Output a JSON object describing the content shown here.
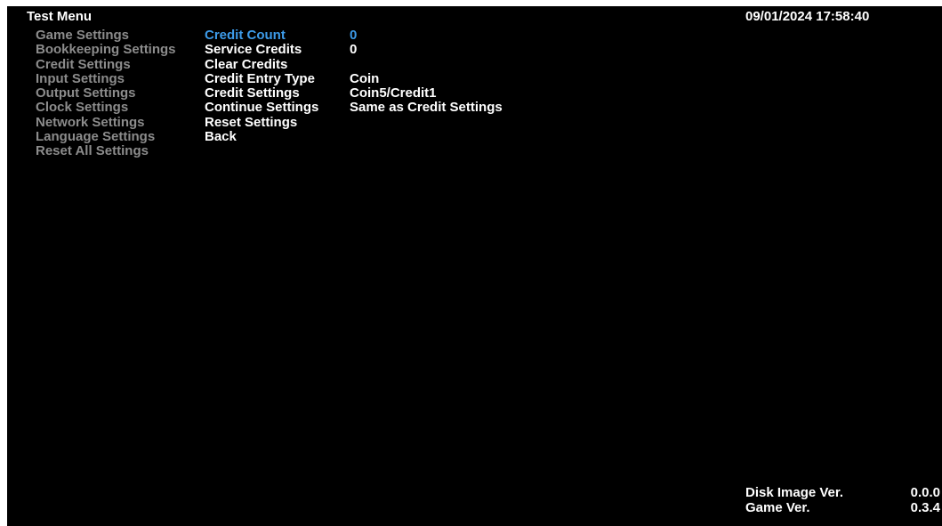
{
  "header": {
    "title": "Test Menu",
    "datetime": "09/01/2024 17:58:40"
  },
  "sidebar": {
    "items": [
      {
        "label": "Game Settings"
      },
      {
        "label": "Bookkeeping Settings"
      },
      {
        "label": "Credit Settings"
      },
      {
        "label": "Input Settings"
      },
      {
        "label": "Output Settings"
      },
      {
        "label": "Clock Settings"
      },
      {
        "label": "Network Settings"
      },
      {
        "label": "Language Settings"
      },
      {
        "label": "Reset All Settings"
      }
    ]
  },
  "menu": {
    "items": [
      {
        "label": "Credit Count",
        "value": "0",
        "selected": true
      },
      {
        "label": "Service Credits",
        "value": "0"
      },
      {
        "label": "Clear Credits",
        "value": ""
      },
      {
        "label": "Credit Entry Type",
        "value": "Coin"
      },
      {
        "label": "Credit Settings",
        "value": "Coin5/Credit1"
      },
      {
        "label": "Continue Settings",
        "value": "Same as Credit Settings"
      },
      {
        "label": "Reset Settings",
        "value": ""
      },
      {
        "label": "Back",
        "value": ""
      }
    ]
  },
  "footer": {
    "disk_image_label": "Disk Image Ver.",
    "disk_image_value": "0.0.0",
    "game_label": "Game Ver.",
    "game_value": "0.3.4"
  },
  "colors": {
    "background": "#000000",
    "text": "#ffffff",
    "inactive": "#8c8c8c",
    "highlight": "#3d9be9"
  }
}
